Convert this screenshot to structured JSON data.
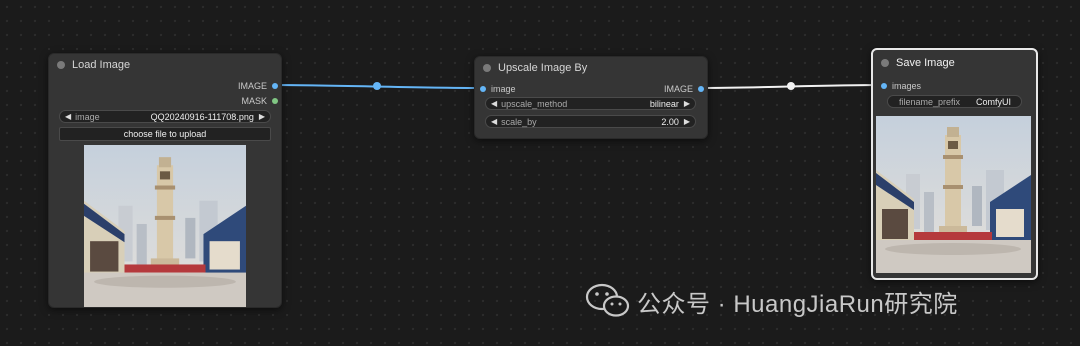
{
  "nodes": {
    "load_image": {
      "title": "Load Image",
      "outputs": [
        "IMAGE",
        "MASK"
      ],
      "image_widget": {
        "label": "image",
        "value": "QQ20240916-111708.png"
      },
      "upload_button": "choose file to upload"
    },
    "upscale": {
      "title": "Upscale Image By",
      "input": "image",
      "output": "IMAGE",
      "method_widget": {
        "label": "upscale_method",
        "value": "bilinear"
      },
      "scale_widget": {
        "label": "scale_by",
        "value": "2.00"
      }
    },
    "save_image": {
      "title": "Save Image",
      "input": "images",
      "prefix_widget": {
        "label": "filename_prefix",
        "value": "ComfyUI"
      }
    }
  },
  "watermark": {
    "text": "公众号 · HuangJiaRun研究院"
  },
  "colors": {
    "image_link": "#64b5f6",
    "mask_slot": "#81c784",
    "selected_border": "#e8e8e8"
  }
}
